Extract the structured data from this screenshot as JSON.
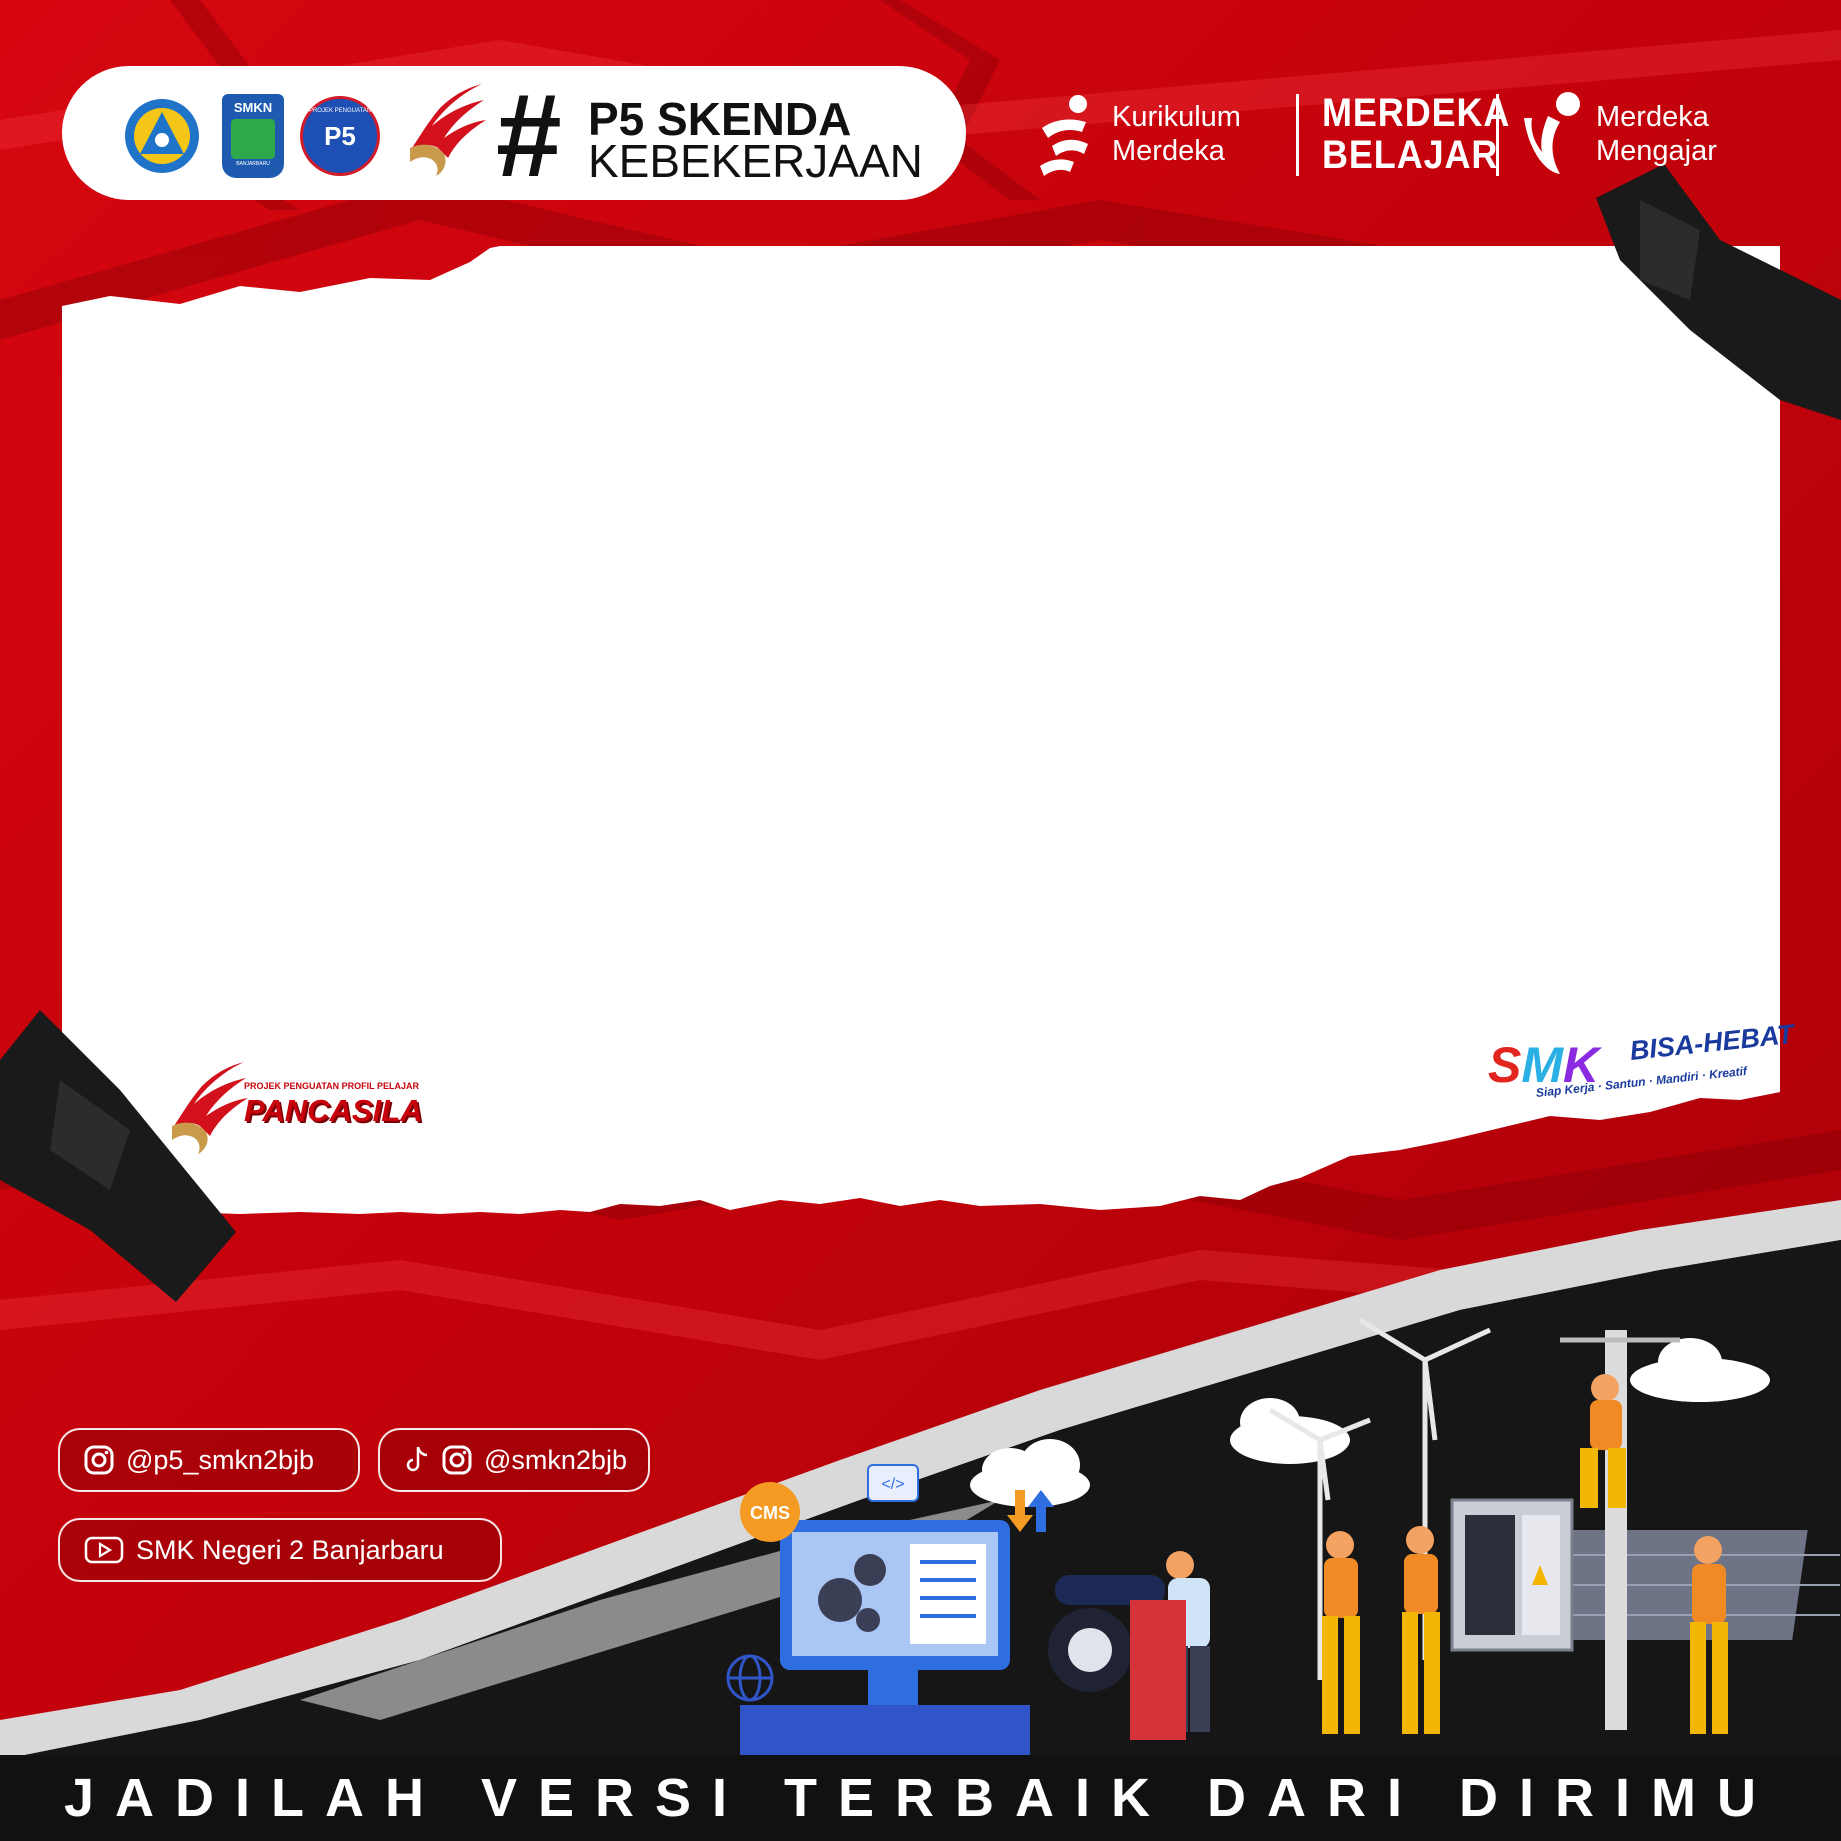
{
  "header": {
    "hashtag": "#",
    "title": "P5 SKENDA",
    "subtitle": "KEBEKERJAAN",
    "logos": {
      "tut_wuri": "TUT WURI HANDAYANI",
      "smkn": "SMKN",
      "smkn_city": "BANJARBARU",
      "p5_ring": "PROJEK PENGUATAN",
      "p5_mark": "P5"
    }
  },
  "partners": {
    "kurikulum_line1": "Kurikulum",
    "kurikulum_line2": "Merdeka",
    "merdeka_belajar_line1": "MERDEKA",
    "merdeka_belajar_line2": "BELAJAR",
    "merdeka_mengajar_line1": "Merdeka",
    "merdeka_mengajar_line2": "Mengajar"
  },
  "pancasila_badge": {
    "small": "PROJEK PENGUATAN PROFIL PELAJAR",
    "big": "PANCASILA"
  },
  "smk_badge": {
    "letters": [
      "S",
      "M",
      "K"
    ],
    "title": "BISA-HEBAT",
    "tagline": "Siap Kerja · Santun · Mandiri · Kreatif"
  },
  "illustration": {
    "cms_badge": "CMS",
    "code_tag": "</>"
  },
  "social": {
    "instagram": "@p5_smkn2bjb",
    "tiktok_instagram": "@smkn2bjb",
    "youtube": "SMK Negeri 2 Banjarbaru"
  },
  "banner": {
    "text": "JADILAH VERSI TERBAIK DARI DIRIMU"
  },
  "colors": {
    "red": "#c8030c",
    "dark_red": "#8e0008",
    "black": "#111111",
    "white": "#ffffff"
  }
}
